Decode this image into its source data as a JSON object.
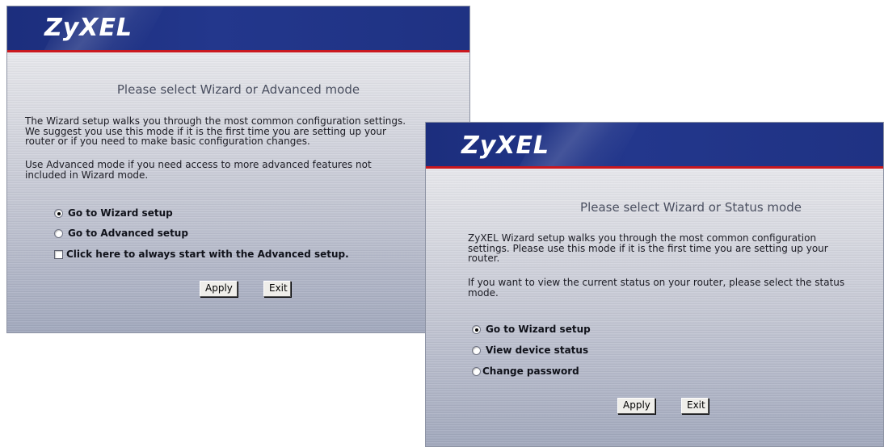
{
  "panel_left": {
    "logo": "ZyXEL",
    "title": "Please select Wizard or Advanced mode",
    "paragraph1_lines": [
      "The Wizard setup walks you through the most common configuration settings.",
      "We suggest you use this mode if it is the first time you are setting up your",
      "router or if you need to make basic configuration changes."
    ],
    "paragraph2_lines": [
      "Use Advanced mode if you need access to more advanced features not",
      "included in Wizard mode."
    ],
    "options": [
      {
        "label": "Go to Wizard setup",
        "selected": true
      },
      {
        "label": "Go to Advanced setup",
        "selected": false
      }
    ],
    "checkbox_label": "Click here to always start with the Advanced setup.",
    "checkbox_checked": false,
    "apply_label": "Apply",
    "exit_label": "Exit"
  },
  "panel_right": {
    "logo": "ZyXEL",
    "title": "Please select Wizard or Status mode",
    "paragraph1_lines": [
      "ZyXEL Wizard setup walks you through the most common configuration",
      "settings. Please use this mode if it is the first time you are setting up your",
      "router."
    ],
    "paragraph2_lines": [
      "If you want to view the current status on your router, please select the status",
      "mode."
    ],
    "options": [
      {
        "label": "Go to Wizard setup",
        "selected": true
      },
      {
        "label": "View device status",
        "selected": false
      },
      {
        "label": "Change password",
        "selected": false
      }
    ],
    "apply_label": "Apply",
    "exit_label": "Exit"
  },
  "colors": {
    "header_blue": "#23378c",
    "header_red_line": "#c9171e",
    "title_text": "#4a4f60"
  }
}
